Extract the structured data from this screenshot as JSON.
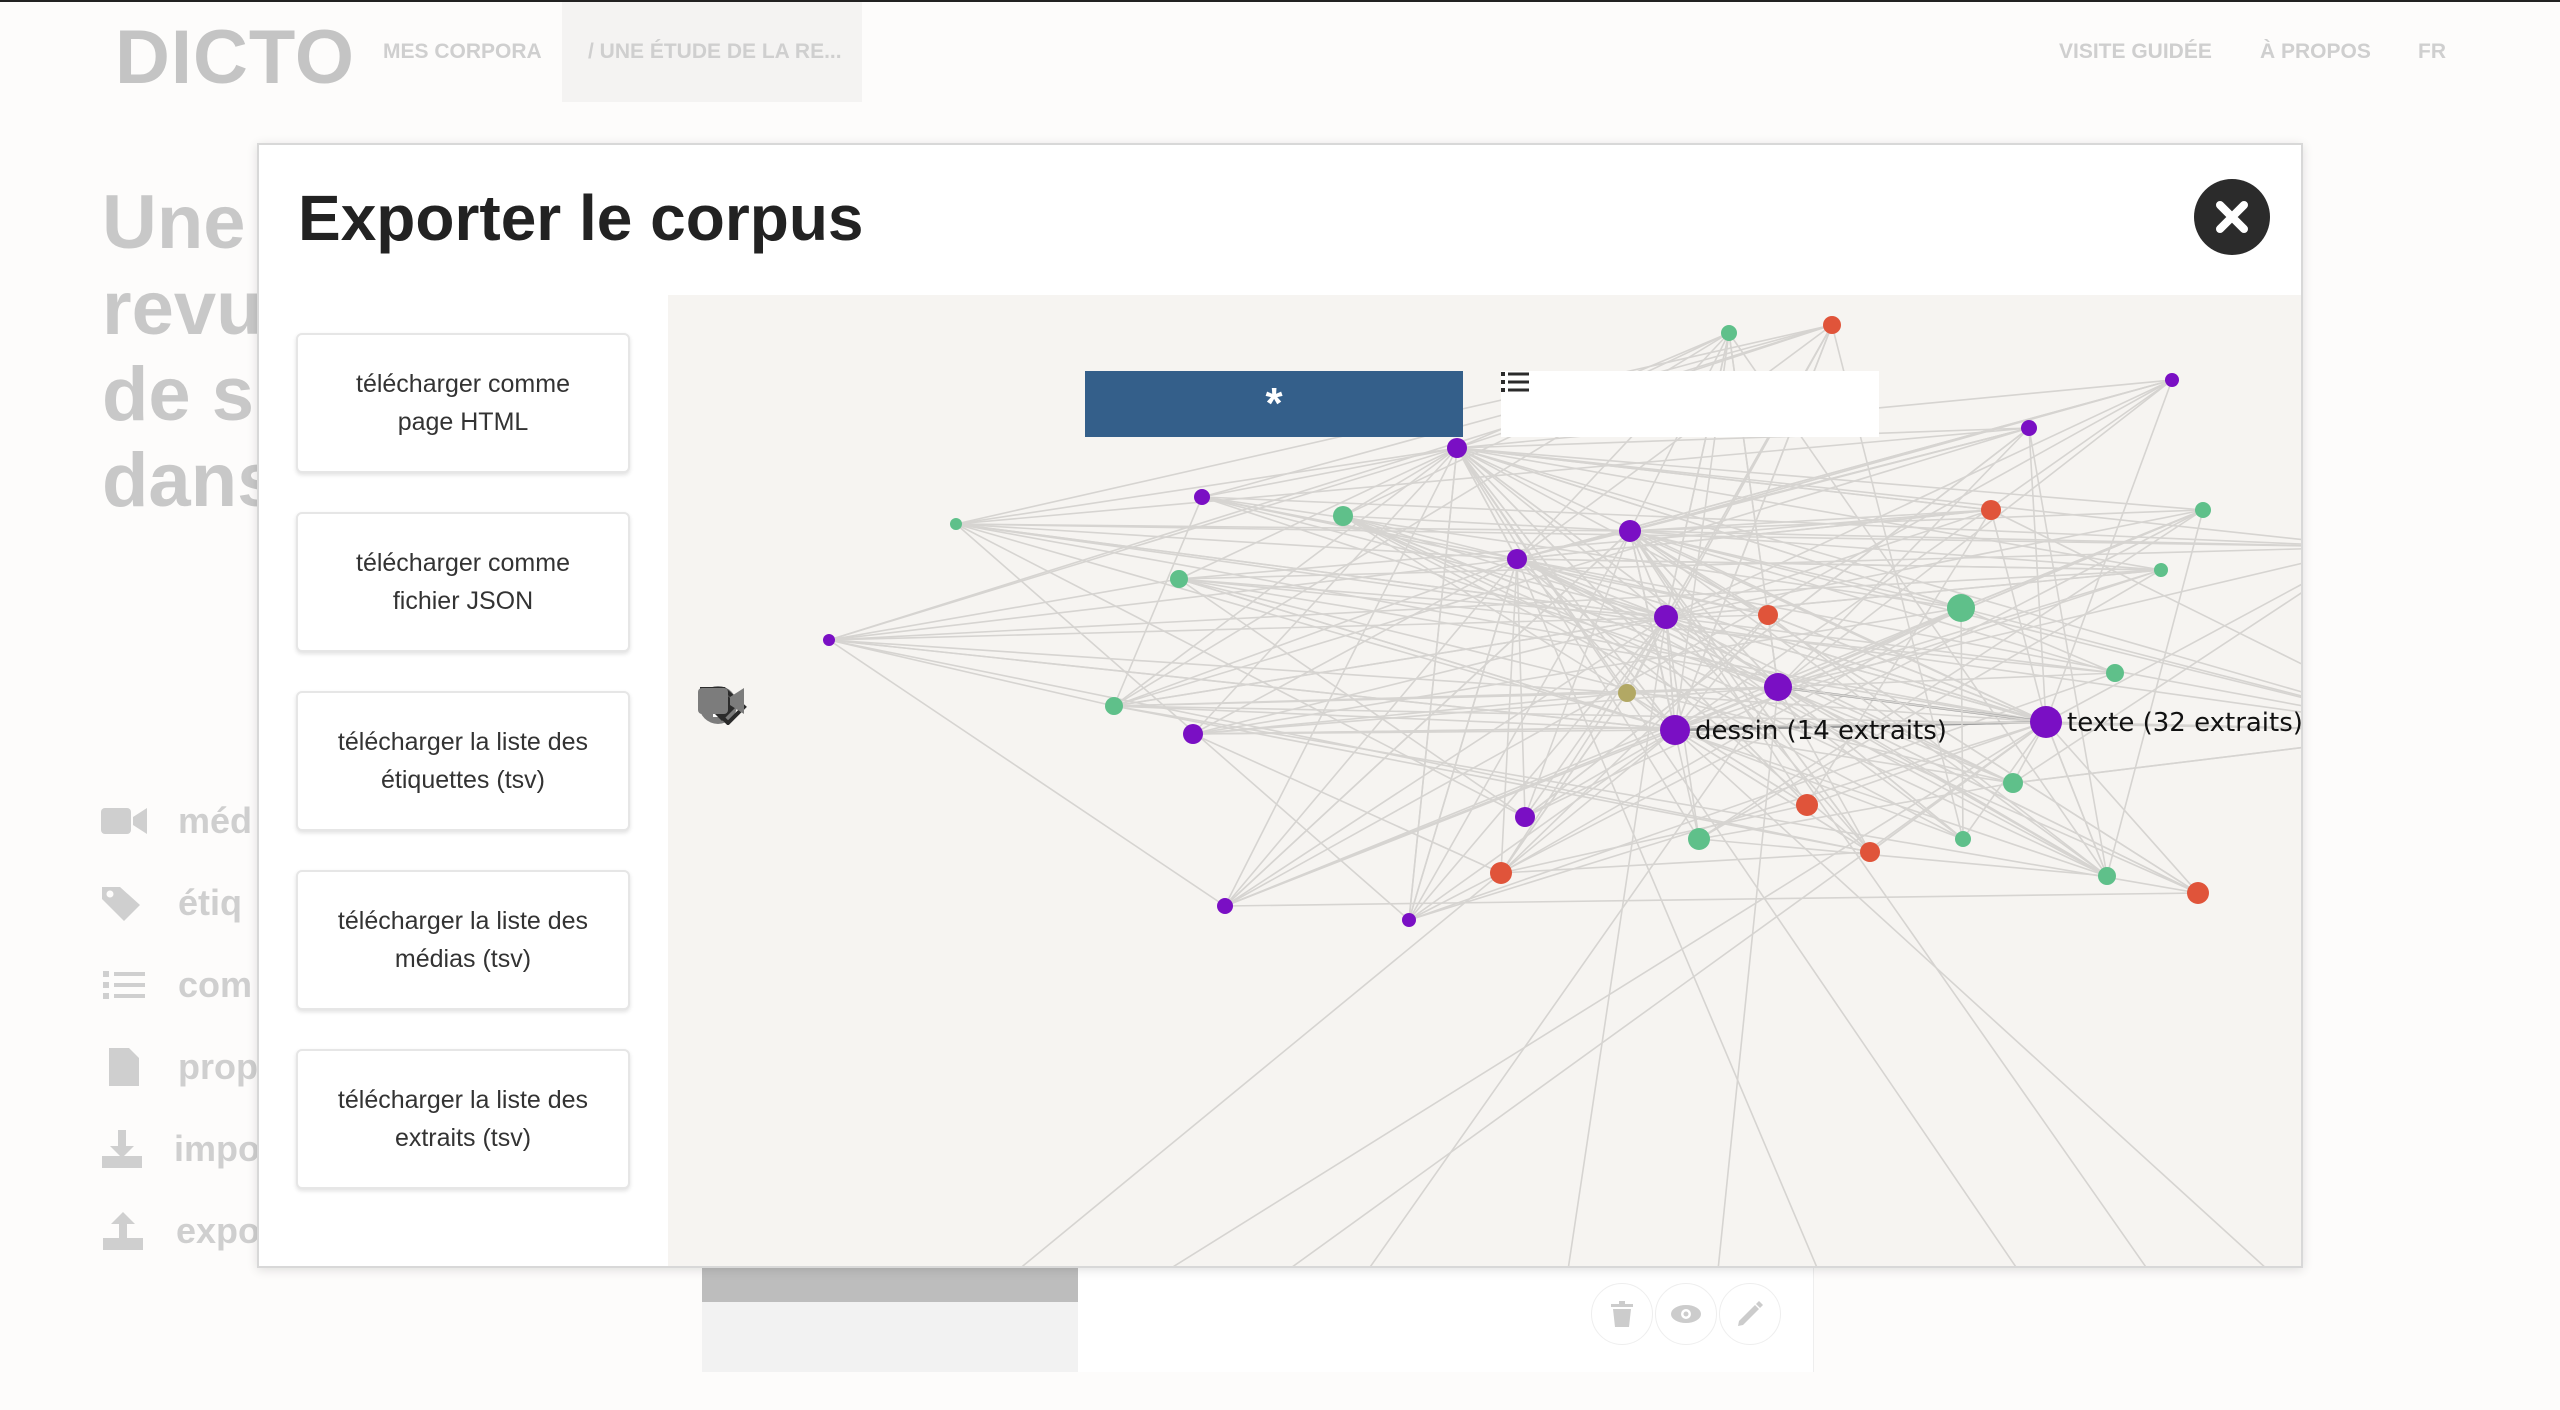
{
  "app": {
    "brand": "DICTO",
    "nav": {
      "my_corpora": "MES CORPORA",
      "breadcrumb": "/ UNE ÉTUDE DE LA RE...",
      "guided_tour": "VISITE GUIDÉE",
      "about": "À PROPOS",
      "lang": "FR"
    },
    "page_title_lines": [
      "Une",
      "revu",
      "de s",
      "dans"
    ],
    "side_menu": [
      {
        "label": "méd",
        "icon": "video-camera-icon"
      },
      {
        "label": "étiq",
        "icon": "tags-icon"
      },
      {
        "label": "com",
        "icon": "list-icon"
      },
      {
        "label": "prop",
        "icon": "file-icon"
      },
      {
        "label": "impo",
        "icon": "download-icon"
      },
      {
        "label": "expo",
        "icon": "upload-icon"
      }
    ],
    "card_actions": [
      "trash-icon",
      "eye-icon",
      "pencil-icon"
    ]
  },
  "modal": {
    "title": "Exporter le corpus",
    "close_icon": "close-icon",
    "export_buttons": [
      "télécharger comme page HTML",
      "télécharger comme fichier JSON",
      "télécharger la liste des étiquettes (tsv)",
      "télécharger la liste des médias (tsv)",
      "télécharger la liste des extraits (tsv)"
    ],
    "viz": {
      "tab_network_label": "*",
      "tab_list_icon": "list-icon",
      "side_icons": [
        "info-icon",
        "tags-icon",
        "video-camera-icon"
      ],
      "labels": {
        "dessin": "dessin (14 extraits)",
        "texte": "texte (32 extraits)"
      },
      "colors": {
        "purple": "#7a0fc4",
        "green": "#5fc08a",
        "red": "#e0543a",
        "olive": "#b2a864",
        "tab_active": "#345f8a",
        "background": "#f6f4f1"
      }
    }
  }
}
